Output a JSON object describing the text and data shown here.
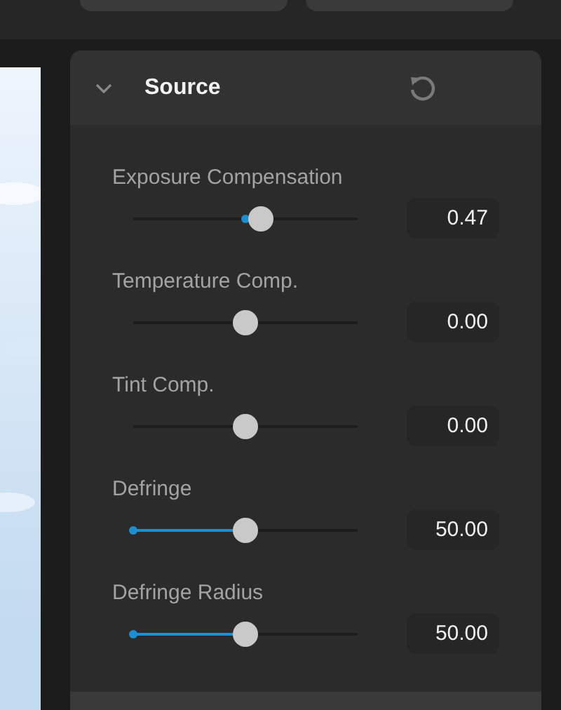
{
  "panel": {
    "title": "Source",
    "expanded": true
  },
  "rows": [
    {
      "label": "Exposure Compensation",
      "kind": "bipolar",
      "level": 0.57,
      "value": "0.47"
    },
    {
      "label": "Temperature Comp.",
      "kind": "bipolar",
      "level": 0.5,
      "value": "0.00"
    },
    {
      "label": "Tint Comp.",
      "kind": "bipolar",
      "level": 0.5,
      "value": "0.00"
    },
    {
      "label": "Defringe",
      "kind": "unipolar",
      "level": 0.5,
      "value": "50.00"
    },
    {
      "label": "Defringe Radius",
      "kind": "unipolar",
      "level": 0.5,
      "value": "50.00"
    }
  ]
}
